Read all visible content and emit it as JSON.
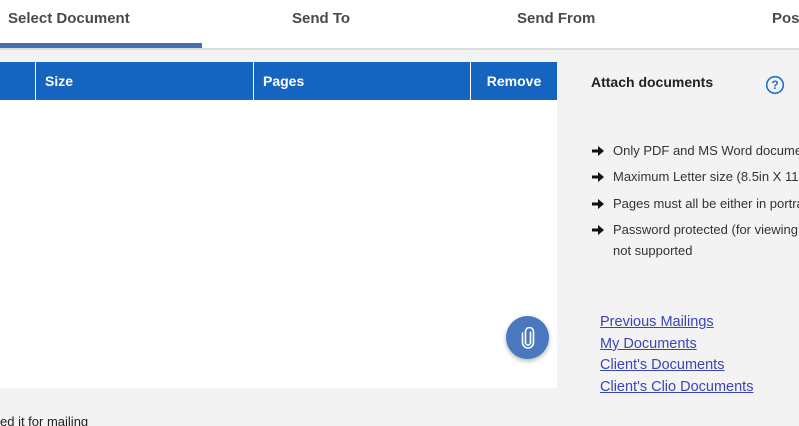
{
  "tabs": [
    "Select Document",
    "Send To",
    "Send From",
    "Pos"
  ],
  "table": {
    "headers": [
      "",
      "Size",
      "Pages",
      "Remove"
    ]
  },
  "side": {
    "title": "Attach documents",
    "rules": [
      [
        "Only PDF and MS Word documer",
        ""
      ],
      [
        "Maximum Letter size (8.5in X 11",
        ""
      ],
      [
        "Pages must all be either in portra",
        ""
      ],
      [
        "Password protected (for viewing",
        "not supported"
      ]
    ],
    "links": [
      "Previous Mailings",
      "My Documents",
      "Client's Documents",
      "Client's Clio Documents"
    ]
  },
  "footer_text": "ed it for mailing",
  "colors": {
    "accent": "#1565c0",
    "fab": "#4a78bf",
    "link": "#3a45b8"
  },
  "icons": {
    "help": "help-circle-icon",
    "arrow": "arrow-right-icon",
    "fab": "paperclip-icon"
  }
}
